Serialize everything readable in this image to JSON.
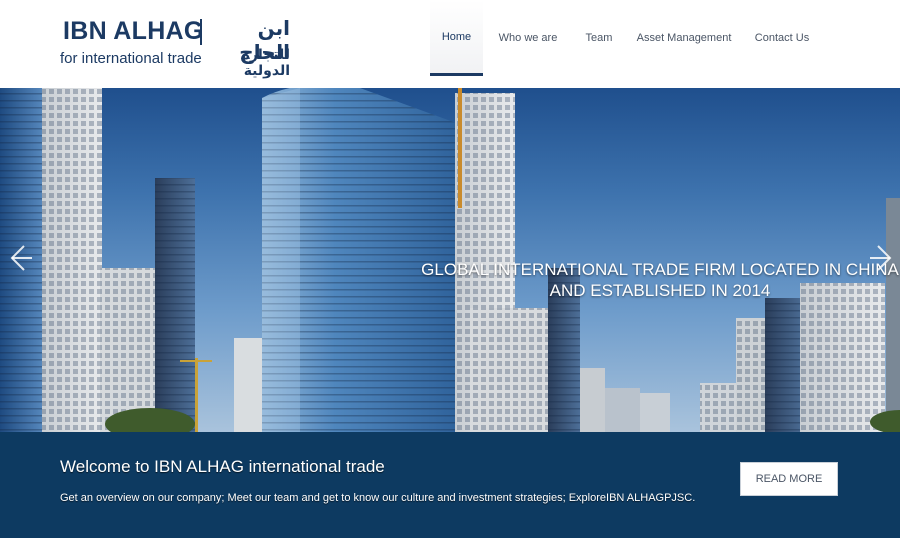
{
  "logo": {
    "title_en": "IBN ALHAG",
    "title_ar": "ابن الحاج",
    "subtitle_en": "for international trade",
    "subtitle_ar": "للتجارة الدولية"
  },
  "nav": {
    "items": [
      {
        "label": "Home",
        "active": true
      },
      {
        "label": "Who we are",
        "active": false
      },
      {
        "label": "Team",
        "active": false
      },
      {
        "label": "Asset Management",
        "active": false
      },
      {
        "label": "Contact Us",
        "active": false
      }
    ]
  },
  "hero": {
    "caption_line1": "GLOBAL INTERNATIONAL TRADE FIRM LOCATED IN CHINA",
    "caption_line2": "AND ESTABLISHED IN 2014",
    "prev_icon": "chevron-left-icon",
    "next_icon": "chevron-right-icon"
  },
  "band": {
    "welcome": "Welcome to IBN ALHAG international trade",
    "overview": "Get an overview on our company; Meet our team and get to know our culture and investment strategies; ExploreIBN ALHAGPJSC.",
    "read_more": "READ MORE"
  },
  "colors": {
    "brand_navy": "#1c3a63",
    "band_background": "#0d3a61",
    "nav_text": "#4a5565"
  }
}
